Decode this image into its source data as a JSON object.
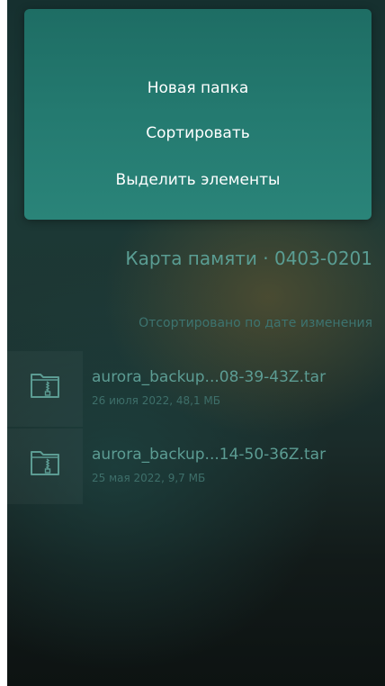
{
  "pulldown_menu": {
    "items": [
      {
        "label": "Новая папка"
      },
      {
        "label": "Сортировать"
      },
      {
        "label": "Выделить элементы"
      }
    ]
  },
  "page": {
    "header": "Карта памяти · 0403-0201",
    "section_header": "Отсортировано по дате изменения"
  },
  "files": [
    {
      "name": "aurora_backup...08-39-43Z.tar",
      "meta": "26 июля 2022, 48,1 МБ",
      "icon": "archive-file-icon"
    },
    {
      "name": "aurora_backup...14-50-36Z.tar",
      "meta": "25 мая 2022, 9,7 МБ",
      "icon": "archive-file-icon"
    }
  ],
  "colors": {
    "menu_background": "#247a70",
    "accent_text": "#5c9c93",
    "secondary_text": "#3e6f6a"
  }
}
